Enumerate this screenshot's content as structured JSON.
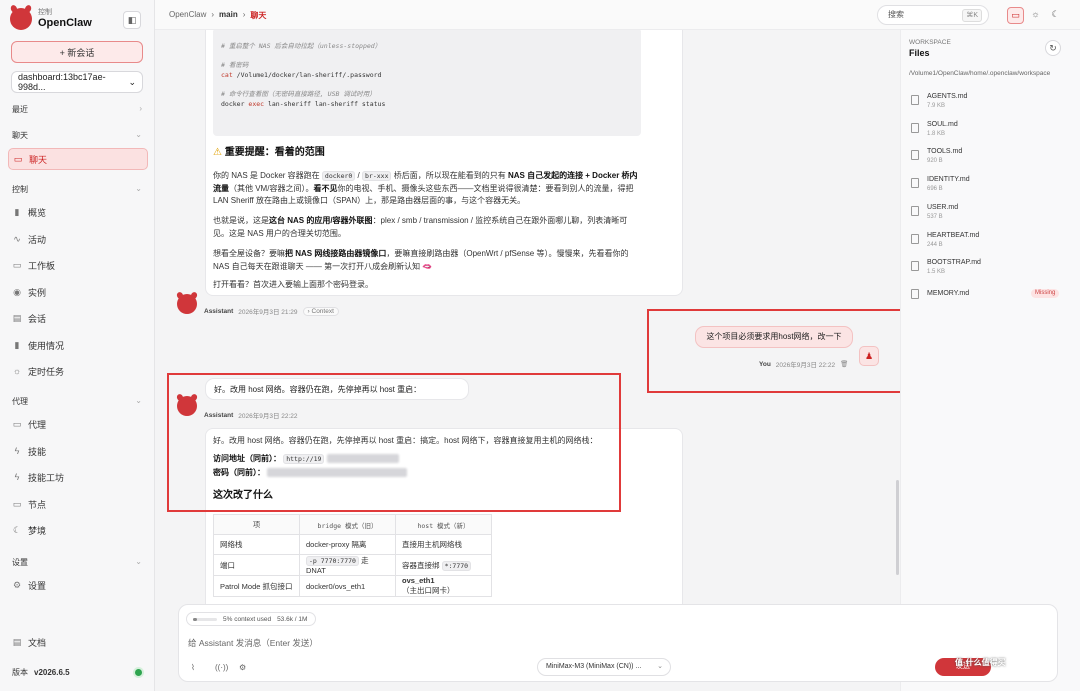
{
  "brand": {
    "sub": "控制",
    "name": "OpenClaw"
  },
  "sidebar": {
    "new_chat": "+ 新会话",
    "session": "dashboard:13bc17ae-998d...",
    "recent": "最近",
    "chat_section": "聊天",
    "chat_item": "聊天",
    "control_section": "控制",
    "control_items": [
      "概览",
      "活动",
      "工作板",
      "实例",
      "会话",
      "使用情况",
      "定时任务"
    ],
    "agent_section": "代理",
    "agent_items": [
      "代理",
      "技能",
      "技能工坊",
      "节点",
      "梦境"
    ],
    "settings_section": "设置",
    "settings_item": "设置",
    "docs": "文档",
    "version_label": "版本",
    "version": "v2026.6.5"
  },
  "topbar": {
    "crumb_root": "OpenClaw",
    "crumb_mid": "main",
    "crumb_cur": "聊天",
    "search": "搜索",
    "shortcut": "⌘K"
  },
  "chat": {
    "code_lines": [
      {
        "t": "# 重启整个 NAS 后会自动拉起（unless-stopped）",
        "c": true
      },
      {
        "t": "",
        "c": false
      },
      {
        "t": "# 看密码",
        "c": true
      },
      {
        "t": "cat /Volume1/docker/lan-sheriff/.password",
        "c": false
      },
      {
        "t": "",
        "c": false
      },
      {
        "t": "# 命令行查看图（无密码直接路径, USB 调试时用）",
        "c": true
      },
      {
        "t": "docker exec lan-sheriff lan-sheriff status",
        "c": false
      }
    ],
    "warn_title": "重要提醒：看着的范围",
    "p1a": "你的 NAS 是 Docker 容器跑在",
    "p1_code1": "docker0",
    "p1_code2": "br-xxx",
    "p1b": "桥后面，所以现在能看到的只有",
    "p1_bold": "NAS 自己发起的连接 + Docker 桥内流量",
    "p1c": "（其他 VM/容器之间）。",
    "p1_bold2": "看不见",
    "p1d": "你的电视、手机、摄像头这些东西——文档里说得很清楚：要看到别人的流量，得把 LAN Sheriff 放在路由上或镜像口（SPAN）上，那是路由器层面的事，与这个容器无关。",
    "p2a": "也就是说，这是",
    "p2_bold": "这台 NAS 的应用/容器外联图",
    "p2b": "：plex / smb / transmission / 监控系统自己在跟外面哪儿聊，列表清晰可见。这是 NAS 用户的合理关切范围。",
    "p3a": "想看全屋设备？要嘛",
    "p3_bold": "把 NAS 网线接路由器镜像口",
    "p3b": "，要嘛直接刷路由器（OpenWrt / pfSense 等）。慢慢来，先看看你的 NAS 自己每天在跟谁聊天 —— 第一次打开八成会刷新认知 🫦",
    "p4": "打开看看？首次进入要输上面那个密码登录。",
    "meta1_name": "Assistant",
    "meta1_time": "2026年9月3日 21:29",
    "meta1_ctx": "› Context",
    "user_msg": "这个项目必须要求用host网络，改一下",
    "user_name": "You",
    "user_time": "2026年9月3日 22:22",
    "reply_short": "好。改用 host 网络。容器仍在跑，先停掉再以 host 重启：",
    "meta2_name": "Assistant",
    "meta2_time": "2026年9月3日 22:22",
    "reply_long": "好。改用 host 网络。容器仍在跑，先停掉再以 host 重启：搞定。host 网络下，容器直接复用主机的网络栈：",
    "addr_label": "访问地址（同前）：",
    "addr_val": "http://19",
    "pwd_label": "密码（同前）：",
    "change_title": "这次改了什么",
    "table_head": [
      "项",
      "bridge 模式（旧）",
      "host 模式（新）"
    ],
    "table_rows": [
      [
        "网络栈",
        "docker-proxy 隔离",
        "直接用主机网络栈"
      ],
      [
        "端口",
        "-p 7770:7770",
        "走 DNAT",
        "容器直接绑",
        "*:7770"
      ],
      [
        "Patrol Mode 抓包接口",
        "docker0/ovs_eth1",
        "ovs_eth1",
        "（主出口网卡）"
      ]
    ]
  },
  "files": {
    "label": "WORKSPACE",
    "title": "Files",
    "path": "/Volume1/OpenClaw/home/.openclaw/workspace",
    "items": [
      {
        "name": "AGENTS.md",
        "size": "7.9 KB"
      },
      {
        "name": "SOUL.md",
        "size": "1.8 KB"
      },
      {
        "name": "TOOLS.md",
        "size": "920 B"
      },
      {
        "name": "IDENTITY.md",
        "size": "696 B"
      },
      {
        "name": "USER.md",
        "size": "537 B"
      },
      {
        "name": "HEARTBEAT.md",
        "size": "244 B"
      },
      {
        "name": "BOOTSTRAP.md",
        "size": "1.5 KB"
      },
      {
        "name": "MEMORY.md",
        "size": "",
        "badge": "Missing"
      }
    ]
  },
  "composer": {
    "context": "5% context used",
    "tokens": "53.6k / 1M",
    "context_fraction": 0.05,
    "placeholder": "给 Assistant 发消息（Enter 发送）",
    "model": "MiniMax-M3 (MiniMax (CN)) ...",
    "send": "发送"
  },
  "watermark": "值·什么值得买",
  "colors": {
    "accent": "#d0363a",
    "accent_soft": "#fbe4e4",
    "annotation_box": "#e03a3a"
  }
}
